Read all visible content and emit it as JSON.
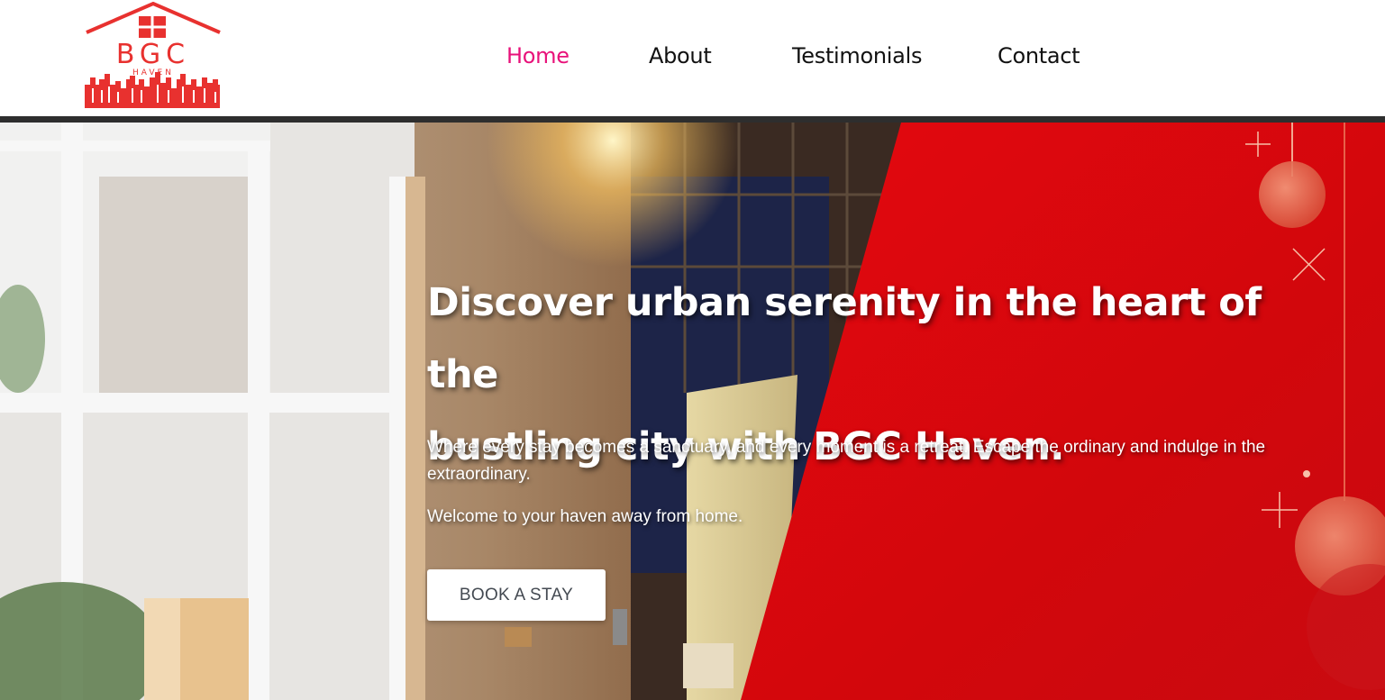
{
  "brand": {
    "logo_text": "BGC",
    "logo_subtext": "HAVEN",
    "logo_color": "#e8312f"
  },
  "nav": {
    "items": [
      {
        "label": "Home",
        "active": true
      },
      {
        "label": "About",
        "active": false
      },
      {
        "label": "Testimonials",
        "active": false
      },
      {
        "label": "Contact",
        "active": false
      }
    ],
    "active_color": "#e8127a"
  },
  "hero": {
    "title_line1": "Discover urban serenity in the heart of the",
    "title_line2": "bustling city with BGC Haven.",
    "subtitle": "Where every stay becomes a sanctuary, and every moment is a retreat. Escape the ordinary and indulge in the extraordinary.",
    "welcome": "Welcome to your haven away from home.",
    "cta_label": "BOOK A STAY",
    "accent_color": "#d8090e"
  }
}
